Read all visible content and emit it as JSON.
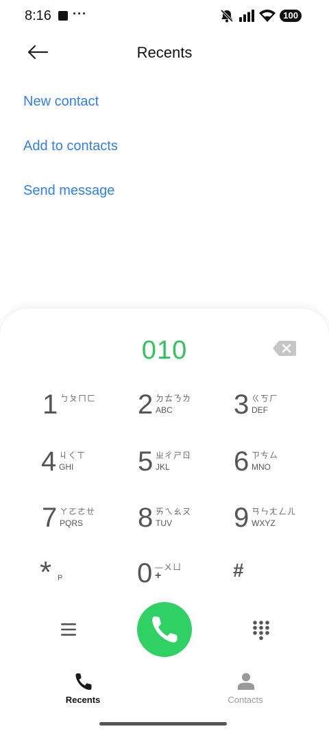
{
  "status_bar": {
    "time": "8:16",
    "extra": "···",
    "battery": "100"
  },
  "header": {
    "title": "Recents"
  },
  "actions": [
    "New contact",
    "Add to contacts",
    "Send message"
  ],
  "dialer": {
    "number": "010",
    "keys": [
      {
        "digit": "1",
        "zhuyin": "ㄅㄆㄇㄈ",
        "letters": ""
      },
      {
        "digit": "2",
        "zhuyin": "ㄉㄊㄋㄌ",
        "letters": "ABC"
      },
      {
        "digit": "3",
        "zhuyin": "ㄍㄎㄏ",
        "letters": "DEF"
      },
      {
        "digit": "4",
        "zhuyin": "ㄐㄑㄒ",
        "letters": "GHI"
      },
      {
        "digit": "5",
        "zhuyin": "ㄓㄔㄕㄖ",
        "letters": "JKL"
      },
      {
        "digit": "6",
        "zhuyin": "ㄗㄘㄙ",
        "letters": "MNO"
      },
      {
        "digit": "7",
        "zhuyin": "ㄚㄛㄜㄝ",
        "letters": "PQRS"
      },
      {
        "digit": "8",
        "zhuyin": "ㄞㄟㄠㄡ",
        "letters": "TUV"
      },
      {
        "digit": "9",
        "zhuyin": "ㄢㄣㄤㄥㄦ",
        "letters": "WXYZ"
      },
      {
        "digit": "*",
        "zhuyin": "",
        "letters": "P"
      },
      {
        "digit": "0",
        "zhuyin": "—ㄨㄩ",
        "letters": "+"
      },
      {
        "digit": "#",
        "zhuyin": "",
        "letters": ""
      }
    ]
  },
  "bottom_nav": {
    "recents": "Recents",
    "contacts": "Contacts"
  },
  "colors": {
    "accent_blue": "#2f7ff0",
    "call_green": "#2fd164",
    "number_green": "#2fc45c"
  }
}
